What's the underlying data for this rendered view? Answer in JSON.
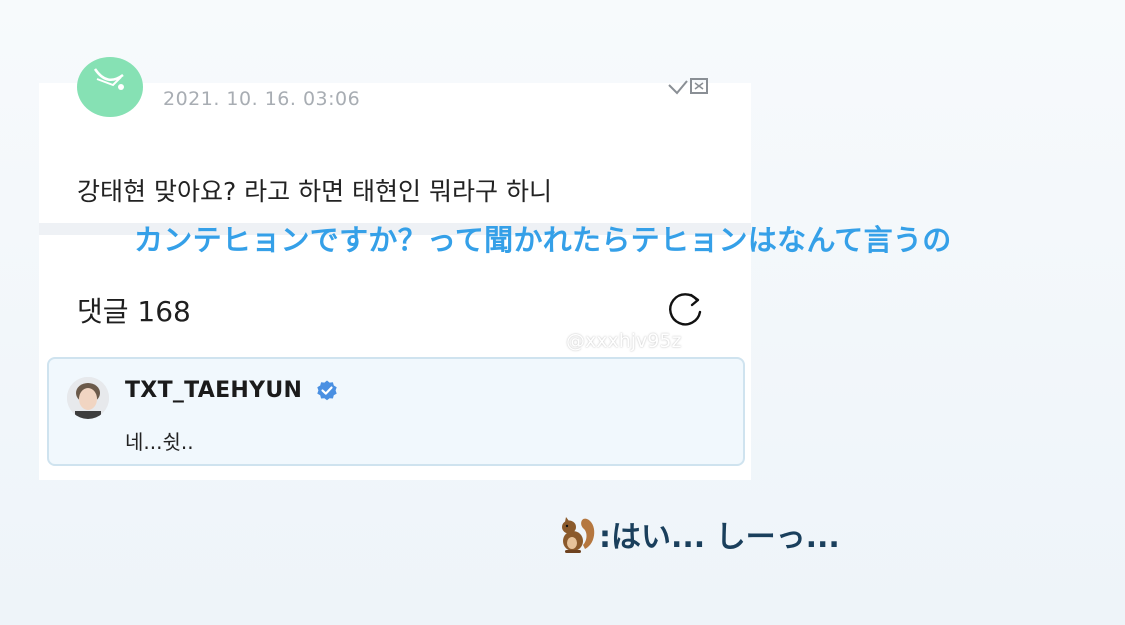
{
  "post": {
    "date": "2021. 10. 16. 03:06",
    "text": "강태현 맞아요? 라고 하면 태현인 뭐라구 하니"
  },
  "translation_caption": "カンテヒョンですか？って聞かれたらテヒョンはなんて言うの",
  "comments": {
    "label": "댓글 168",
    "watermark": "@xxxhjv95z",
    "items": [
      {
        "username": "TXT_TAEHYUN",
        "verified": true,
        "text": "네...쉿.."
      }
    ]
  },
  "bottom_caption": ":はい... しーっ...",
  "colors": {
    "caption_blue": "#35a0e8",
    "verified_blue": "#4a90e2",
    "comment_border": "#cfe3ef",
    "avatar_green": "#86e1b4",
    "bottom_text": "#1a3f5c"
  },
  "icons": [
    "weverse-avatar-icon",
    "expand-icon",
    "refresh-icon",
    "verified-icon",
    "squirrel-icon"
  ]
}
